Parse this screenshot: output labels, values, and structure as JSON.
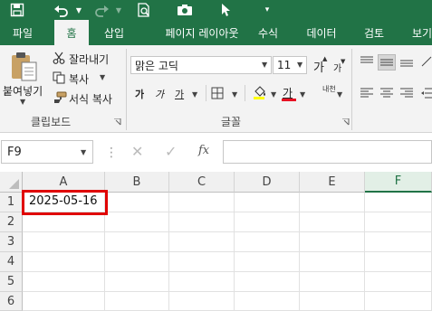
{
  "quick_access": {
    "icons": [
      "save-icon",
      "undo-icon",
      "redo-icon",
      "print-preview-icon",
      "camera-icon",
      "select-pointer-icon",
      "customize-quick-access-icon"
    ]
  },
  "tabs": [
    "파일",
    "홈",
    "삽입",
    "페이지 레이아웃",
    "수식",
    "데이터",
    "검토",
    "보기"
  ],
  "active_tab": "홈",
  "clipboard": {
    "paste_label": "붙여넣기",
    "cut_label": "잘라내기",
    "copy_label": "복사",
    "format_painter_label": "서식 복사",
    "group_label": "클립보드"
  },
  "font": {
    "font_name": "맑은 고딕",
    "font_size": "11",
    "grow_label": "가",
    "shrink_label": "가",
    "bold_label": "가",
    "italic_label": "가",
    "underline_label": "가",
    "font_color_label": "가",
    "phonetic_label": "내천",
    "group_label": "글꼴",
    "font_color": "#e81123"
  },
  "formula_bar": {
    "name_box": "F9",
    "cancel_symbol": "✕",
    "enter_symbol": "✓",
    "function_symbol": "fx",
    "content": ""
  },
  "sheet": {
    "columns": [
      "A",
      "B",
      "C",
      "D",
      "E",
      "F"
    ],
    "rows": [
      "1",
      "2",
      "3",
      "4",
      "5",
      "6"
    ],
    "selected_column": "F",
    "cells": {
      "A1": "2025-05-16"
    },
    "highlight_color": "#e00000"
  },
  "colors": {
    "accent": "#217346"
  }
}
